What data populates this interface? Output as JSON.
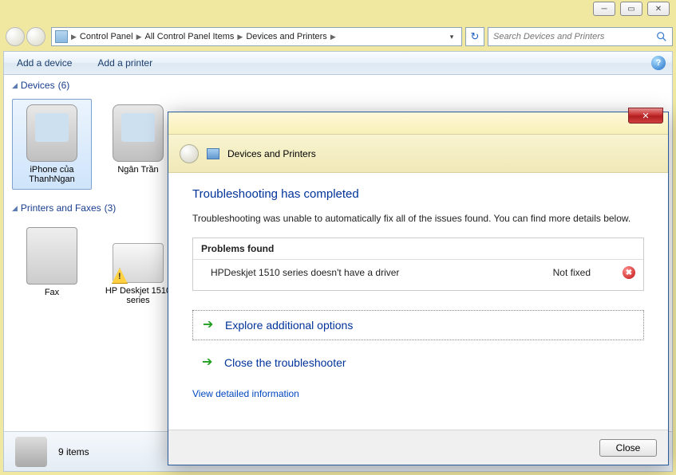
{
  "window": {
    "minimize": "─",
    "maximize": "▭",
    "close": "✕"
  },
  "breadcrumb": {
    "items": [
      "Control Panel",
      "All Control Panel Items",
      "Devices and Printers"
    ]
  },
  "search": {
    "placeholder": "Search Devices and Printers"
  },
  "toolbar": {
    "add_device": "Add a device",
    "add_printer": "Add a printer"
  },
  "sections": {
    "devices": {
      "title": "Devices",
      "count": "(6)"
    },
    "printers": {
      "title": "Printers and Faxes",
      "count": "(3)"
    }
  },
  "devices": [
    {
      "label": "iPhone của ThanhNgan"
    },
    {
      "label": "Ngân Trần"
    }
  ],
  "printers": [
    {
      "label": "Fax"
    },
    {
      "label": "HP Deskjet 1510 series"
    }
  ],
  "status": {
    "count": "9 items"
  },
  "dialog": {
    "header": "Devices and Printers",
    "title": "Troubleshooting has completed",
    "message": "Troubleshooting was unable to automatically fix all of the issues found. You can find more details below.",
    "problems_header": "Problems found",
    "problem": {
      "text": "HPDeskjet 1510 series doesn't have a driver",
      "status": "Not fixed"
    },
    "action_explore": "Explore additional options",
    "action_close_ts": "Close the troubleshooter",
    "detail_link": "View detailed information",
    "close_btn": "Close",
    "x": "✕"
  }
}
